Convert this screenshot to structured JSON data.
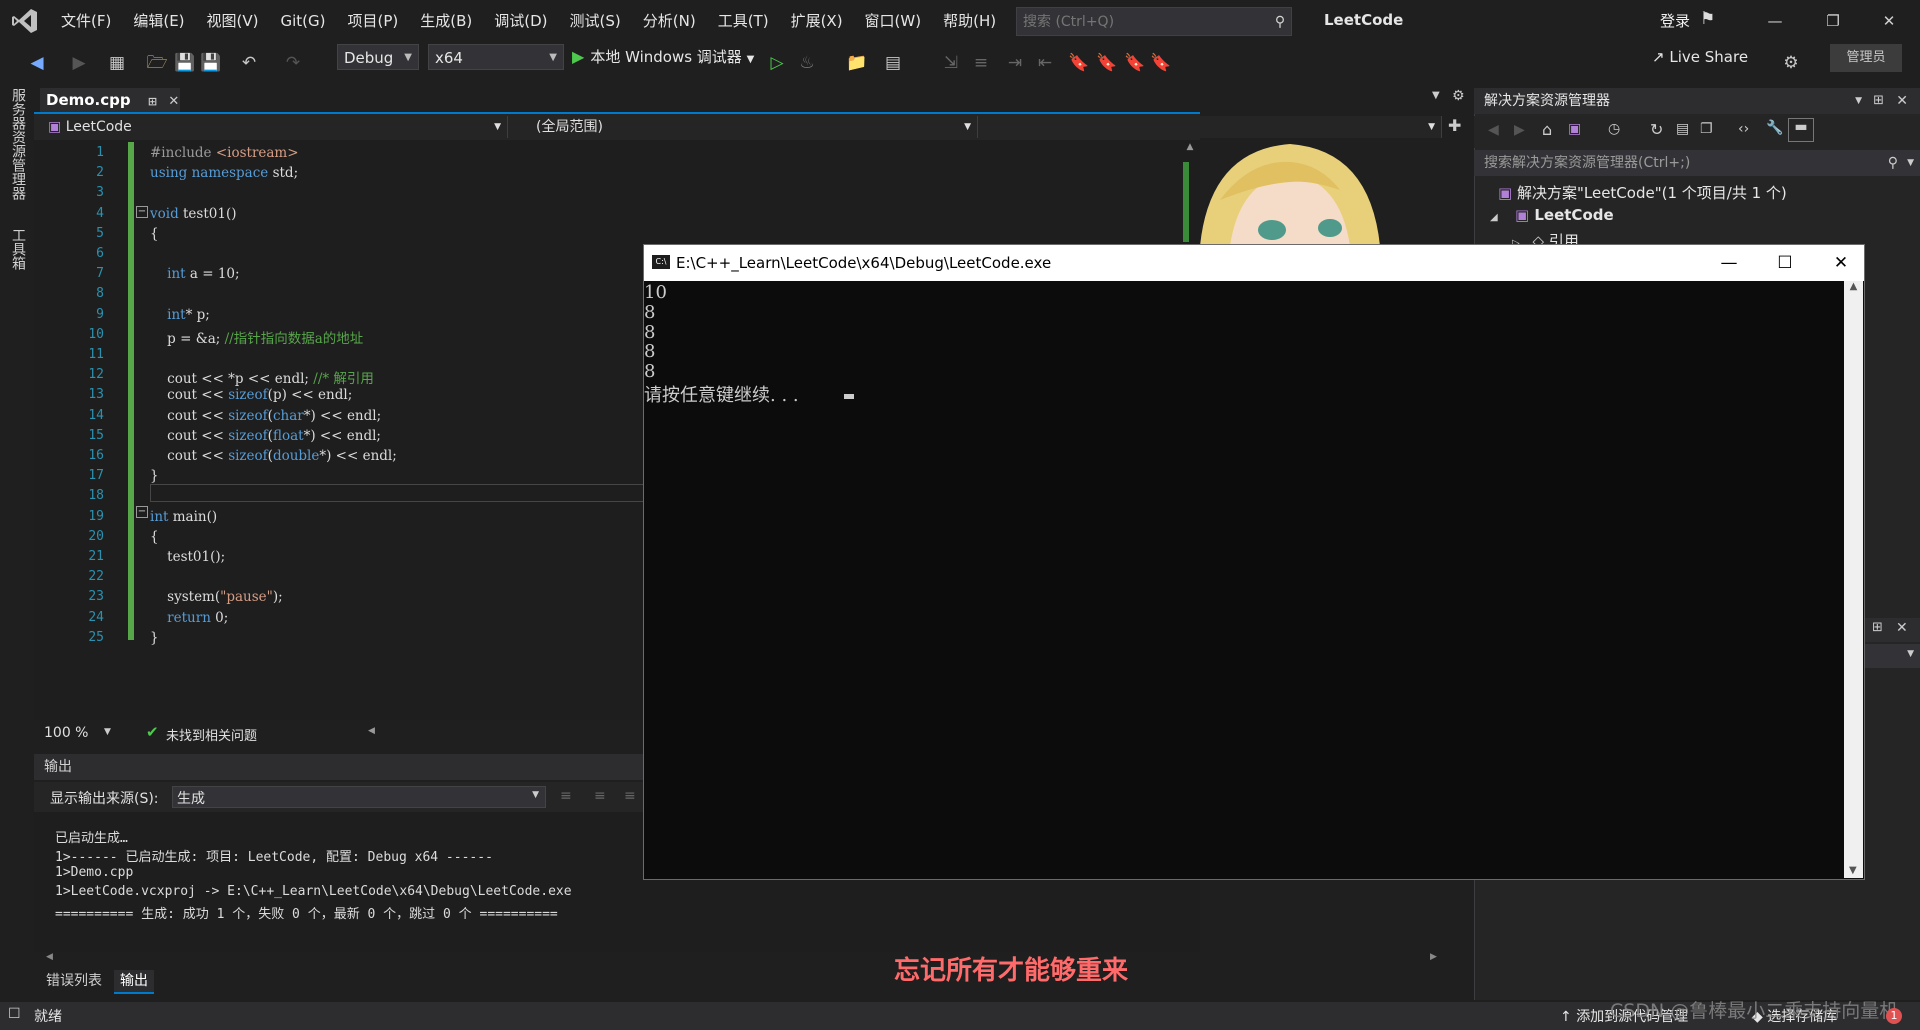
{
  "menubar": {
    "items": [
      "文件(F)",
      "编辑(E)",
      "视图(V)",
      "Git(G)",
      "项目(P)",
      "生成(B)",
      "调试(D)",
      "测试(S)",
      "分析(N)",
      "工具(T)",
      "扩展(X)",
      "窗口(W)",
      "帮助(H)"
    ],
    "search_placeholder": "搜索 (Ctrl+Q)",
    "window_title": "LeetCode",
    "login": "登录"
  },
  "toolbar": {
    "config": "Debug",
    "platform": "x64",
    "run_label": "本地 Windows 调试器",
    "live_share": "Live Share",
    "admin": "管理员"
  },
  "leftbar": {
    "server_explorer": "服务器资源管理器",
    "toolbox": "工具箱"
  },
  "editor": {
    "tab_name": "Demo.cpp",
    "nav_project": "LeetCode",
    "nav_scope": "(全局范围)",
    "zoom": "100 %",
    "issues": "未找到相关问题",
    "lines": [
      "#include <iostream>",
      "using namespace std;",
      "",
      "void test01()",
      "{",
      "",
      "    int a = 10;",
      "",
      "    int* p;",
      "    p = &a; //指针指向数据a的地址",
      "",
      "    cout << *p << endl; //* 解引用",
      "    cout << sizeof(p) << endl;",
      "    cout << sizeof(char*) << endl;",
      "    cout << sizeof(float*) << endl;",
      "    cout << sizeof(double*) << endl;",
      "}",
      "",
      "int main()",
      "{",
      "    test01();",
      "",
      "    system(\"pause\");",
      "    return 0;",
      "}"
    ]
  },
  "output": {
    "title": "输出",
    "source_label": "显示输出来源(S):",
    "source_value": "生成",
    "lines": [
      "已启动生成…",
      "1>------ 已启动生成: 项目: LeetCode, 配置: Debug x64 ------",
      "1>Demo.cpp",
      "1>LeetCode.vcxproj -> E:\\C++_Learn\\LeetCode\\x64\\Debug\\LeetCode.exe",
      "========== 生成: 成功 1 个，失败 0 个，最新 0 个，跳过 0 个 =========="
    ],
    "tabs": [
      "错误列表",
      "输出"
    ]
  },
  "solution_explorer": {
    "title": "解决方案资源管理器",
    "search_placeholder": "搜索解决方案资源管理器(Ctrl+;)",
    "solution": "解决方案\"LeetCode\"(1 个项目/共 1 个)",
    "project": "LeetCode",
    "references": "引用"
  },
  "console": {
    "title": "E:\\C++_Learn\\LeetCode\\x64\\Debug\\LeetCode.exe",
    "icon_text": "C:\\",
    "lines": [
      "10",
      "8",
      "8",
      "8",
      "8",
      "请按任意键继续. . ."
    ]
  },
  "overlay": {
    "subtitle": "忘记所有才能够重来",
    "watermark": "CSDN @鲁棒最小二乘支持向量机"
  },
  "statusbar": {
    "ready": "就绪",
    "add_source": "添加到源代码管理",
    "select_repo": "选择存储库",
    "badge": "1"
  }
}
